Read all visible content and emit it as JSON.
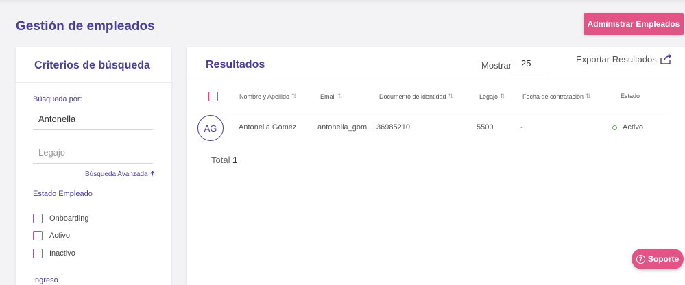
{
  "page": {
    "title": "Gestión de empleados",
    "admin_button": "Administrar Empleados"
  },
  "search": {
    "title": "Criterios de búsqueda",
    "search_by_label": "Búsqueda por:",
    "search_by_value": "Antonella",
    "legajo_placeholder": "Legajo",
    "advanced": "Búsqueda Avanzada",
    "estado_label": "Estado Empleado",
    "estados": [
      "Onboarding",
      "Activo",
      "Inactivo"
    ],
    "ingreso_label": "Ingreso"
  },
  "results": {
    "title": "Resultados",
    "mostrar_label": "Mostrar",
    "mostrar_value": "25",
    "export_label": "Exportar Resultados",
    "columns": [
      "Nombre y Apellido",
      "Email",
      "Documento de identidad",
      "Legajo",
      "Fecha de contratación",
      "Estado"
    ],
    "rows": [
      {
        "initials": "AG",
        "name": "Antonella Gomez",
        "email": "antonella_gom...",
        "document": "36985210",
        "legajo": "5500",
        "hire_date": "-",
        "status": "Activo"
      }
    ],
    "total_label": "Total",
    "total_value": "1"
  },
  "support": {
    "label": "Soporte"
  },
  "colors": {
    "primary": "#4a3f96",
    "accent": "#e35486",
    "status_active": "#4caf50"
  }
}
